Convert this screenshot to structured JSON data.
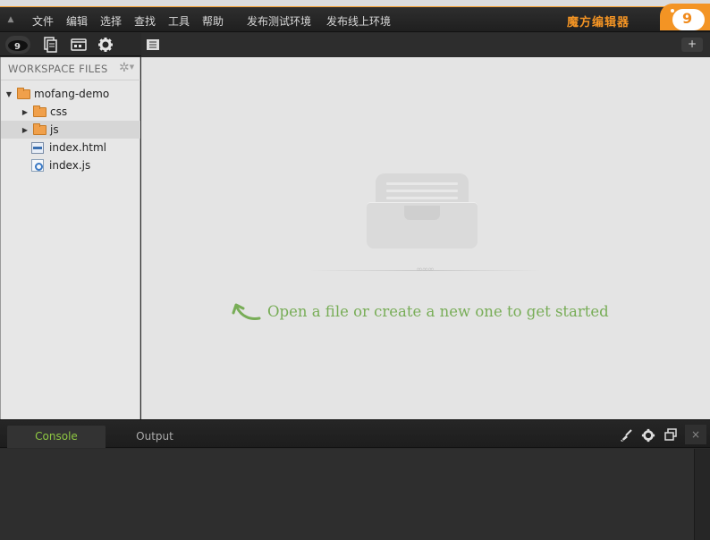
{
  "menubar": {
    "items": [
      "文件",
      "编辑",
      "选择",
      "查找",
      "工具",
      "帮助",
      "发布测试环境",
      "发布线上环境"
    ],
    "brand": "魔方编辑器",
    "logo_glyph": "9"
  },
  "toolbar": {
    "sidebar_tabs": [
      "cloud-icon",
      "files-icon",
      "terminal-icon",
      "gear-icon"
    ],
    "add_tab_label": "+"
  },
  "sidebar": {
    "header": "WORKSPACE FILES",
    "tree": [
      {
        "label": "mofang-demo",
        "type": "folder",
        "expanded": true,
        "depth": 0
      },
      {
        "label": "css",
        "type": "folder",
        "expanded": false,
        "depth": 1
      },
      {
        "label": "js",
        "type": "folder",
        "expanded": false,
        "depth": 1,
        "selected": true
      },
      {
        "label": "index.html",
        "type": "html",
        "depth": 1
      },
      {
        "label": "index.js",
        "type": "js",
        "depth": 1
      }
    ]
  },
  "editor": {
    "empty_message": "Open a file or create a new one to get started"
  },
  "bottom_panel": {
    "tabs": [
      "Console",
      "Output"
    ],
    "active_tab": "Console",
    "close_label": "×"
  },
  "colors": {
    "accent_orange": "#f39424",
    "hint_green": "#78ad57",
    "console_tab_green": "#8ec742"
  }
}
